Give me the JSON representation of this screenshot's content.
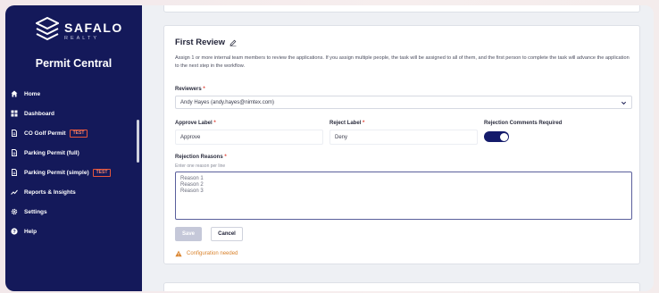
{
  "brand": {
    "name": "SAFALO",
    "sub": "REALTY"
  },
  "app_name": "Permit Central",
  "nav": [
    {
      "label": "Home",
      "icon": "home-icon"
    },
    {
      "label": "Dashboard",
      "icon": "dashboard-icon"
    },
    {
      "label": "CO Golf Permit",
      "icon": "document-icon",
      "badge": "TEST"
    },
    {
      "label": "Parking Permit (full)",
      "icon": "document-icon"
    },
    {
      "label": "Parking Permit (simple)",
      "icon": "document-icon",
      "badge": "TEST"
    },
    {
      "label": "Reports & Insights",
      "icon": "trend-icon"
    },
    {
      "label": "Settings",
      "icon": "gear-icon"
    },
    {
      "label": "Help",
      "icon": "help-icon"
    }
  ],
  "card": {
    "title": "First Review",
    "description": "Assign 1 or more internal team members to review the applications. If you assign multiple people, the task will be assigned to all of them, and the first person to complete the task will advance the application to the next step in the workflow.",
    "reviewers_label": "Reviewers",
    "reviewers_value": "Andy Hayes (andy.hayes@nimtex.com)",
    "approve_label": "Approve Label",
    "approve_value": "Approve",
    "reject_label": "Reject Label",
    "reject_value": "Deny",
    "rejection_comments_label": "Rejection Comments Required",
    "rejection_comments_on": true,
    "rejection_reasons_label": "Rejection Reasons",
    "rejection_reasons_hint": "Enter one reason per line",
    "rejection_reasons_value": "Reason 1\nReason 2\nReason 3",
    "required_mark": "*",
    "save_label": "Save",
    "cancel_label": "Cancel",
    "warning": "Configuration needed"
  },
  "colors": {
    "sidebar": "#14195a",
    "accent": "#141b6b",
    "warning": "#d9822b",
    "required": "#e0453a"
  }
}
